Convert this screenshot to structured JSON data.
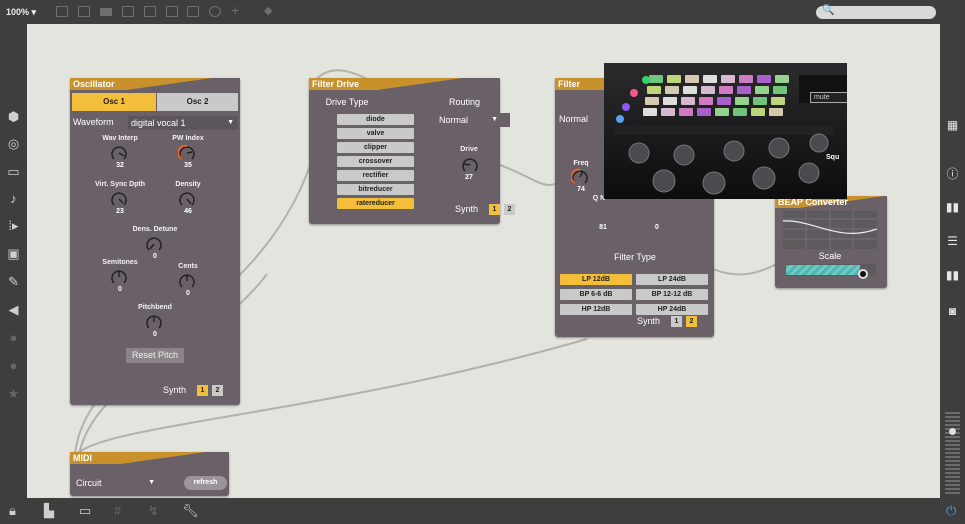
{
  "toolbar": {
    "zoom": "100% ▾"
  },
  "search": {
    "placeholder": "🔍"
  },
  "oscillator": {
    "title": "Oscillator",
    "tabs": [
      "Osc 1",
      "Osc 2"
    ],
    "waveform_label": "Waveform",
    "waveform_value": "digital vocal 1",
    "knobs": [
      {
        "label": "Wav Interp",
        "value": "32"
      },
      {
        "label": "PW Index",
        "value": "35"
      },
      {
        "label": "Virt. Sync Dpth",
        "value": "23"
      },
      {
        "label": "Density",
        "value": "46"
      },
      {
        "label": "Dens. Detune",
        "value": "0"
      },
      {
        "label": "Semitones",
        "value": "0"
      },
      {
        "label": "Cents",
        "value": "0"
      },
      {
        "label": "Pitchbend",
        "value": "0"
      }
    ],
    "reset_label": "Reset Pitch",
    "synth_label": "Synth",
    "synth_buttons": [
      "1",
      "2"
    ]
  },
  "filter_drive": {
    "title": "Filter Drive",
    "drive_type_label": "Drive Type",
    "types": [
      "diode",
      "valve",
      "clipper",
      "crossover",
      "rectifier",
      "bitreducer",
      "ratereducer"
    ],
    "routing_label": "Routing",
    "routing_value": "Normal",
    "drive_label": "Drive",
    "drive_value": "27",
    "synth_label": "Synth",
    "synth_buttons": [
      "1",
      "2"
    ]
  },
  "filter": {
    "title": "Filter",
    "mode_value": "Normal",
    "freq_label": "Freq",
    "freq_value": "74",
    "q_label": "Q N",
    "q_value": "81",
    "third_value": "0",
    "filter_type_label": "Filter Type",
    "types": [
      "LP 12dB",
      "LP 24dB",
      "BP 6-6 dB",
      "BP 12-12 dB",
      "HP 12dB",
      "HP 24dB"
    ],
    "synth_label": "Synth",
    "synth_buttons": [
      "1",
      "2"
    ]
  },
  "beap": {
    "title": "BEAP Converter",
    "scale_label": "Scale"
  },
  "overlay": {
    "mute_label": "mute",
    "squ_label": "Squ"
  },
  "midi": {
    "title": "MIDI",
    "device_value": "Circuit",
    "refresh_label": "refresh"
  },
  "colors": {
    "accent": "#f3bf3a",
    "panel": "#6a6168",
    "title_bar": "#c8912c",
    "canvas": "#e4e4df",
    "chrome": "#3e3e3e",
    "cable": "#b2b2aa",
    "beap_bar": "#4fb6b0"
  },
  "icons": {
    "left": [
      "cube-icon",
      "target-icon",
      "patcher-icon",
      "note-icon",
      "step-icon",
      "image-icon",
      "clip-icon",
      "plug-icon",
      "info-dim-icon",
      "settings-dim-icon",
      "star-dim-icon"
    ],
    "right": [
      "grid-icon",
      "info-icon",
      "columns-icon",
      "list-icon",
      "panel-icon",
      "camera-icon"
    ]
  }
}
